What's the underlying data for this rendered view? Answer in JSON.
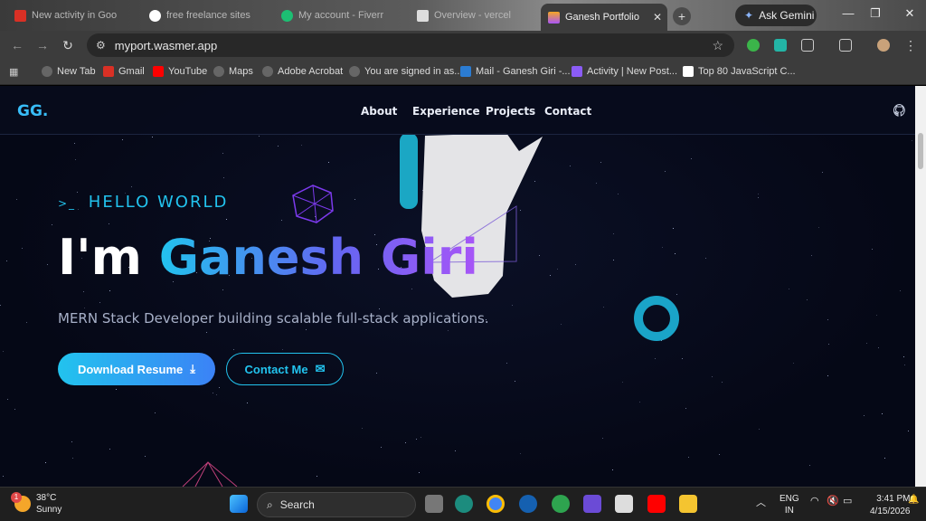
{
  "tabs": [
    {
      "label": "New activity in Goo",
      "color": "#d93025"
    },
    {
      "label": "free freelance sites",
      "color": "#4285f4"
    },
    {
      "label": "My account - Fiverr",
      "color": "#1dbf73"
    },
    {
      "label": "Overview - vercel",
      "color": "#ffffff"
    },
    {
      "label": "Ganesh Portfolio",
      "color": "#f5a623"
    }
  ],
  "window": {
    "ask_gemini": "Ask Gemini",
    "new_tab": "+"
  },
  "address": {
    "url": "myport.wasmer.app"
  },
  "bookmarks": [
    {
      "label": "New Tab"
    },
    {
      "label": "Gmail"
    },
    {
      "label": "YouTube"
    },
    {
      "label": "Maps"
    },
    {
      "label": "Adobe Acrobat"
    },
    {
      "label": "You are signed in as..."
    },
    {
      "label": "Mail - Ganesh Giri -..."
    },
    {
      "label": "Activity | New Post..."
    },
    {
      "label": "Top 80 JavaScript C..."
    }
  ],
  "site": {
    "logo": "GG.",
    "nav": [
      "About",
      "Experience",
      "Projects",
      "Contact"
    ],
    "hello": "HELLO WORLD",
    "hello_prefix": ">_",
    "headline_prefix": "I'm ",
    "name": "Ganesh Giri",
    "subtitle": "MERN Stack Developer building scalable full-stack applications.",
    "btn_resume": "Download Resume",
    "btn_contact": "Contact Me"
  },
  "taskbar": {
    "temp": "38°C",
    "condition": "Sunny",
    "weather_badge": "1",
    "search": "Search",
    "lang1": "ENG",
    "lang2": "IN",
    "time": "3:41 PM",
    "date": "4/15/2026"
  }
}
